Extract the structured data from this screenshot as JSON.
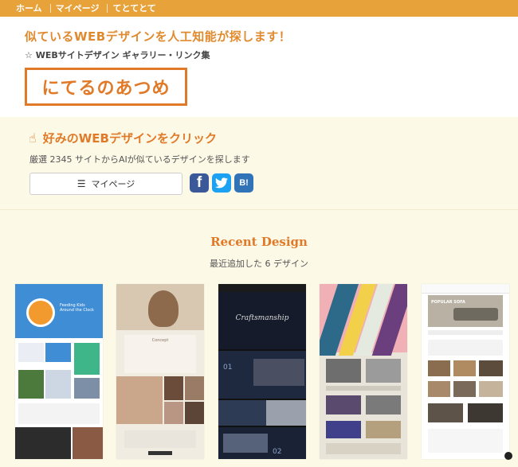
{
  "nav": {
    "items": [
      "ホーム",
      "マイページ",
      "てとてとて"
    ]
  },
  "header": {
    "tagline": "似ているWEBデザインを人工知能が探します！",
    "subtagline": "☆ WEBサイトデザイン ギャラリー・リンク集",
    "logo": "にてるのあつめ"
  },
  "intro": {
    "title": "好みのWEBデザインをクリック",
    "description": "厳選 2345 サイトからAIが似ているデザインを探します",
    "mypage_button": "マイページ"
  },
  "social": {
    "facebook": "f",
    "twitter": "t",
    "hatena": "B!"
  },
  "recent": {
    "title": "Recent Design",
    "subtitle": "最近追加した 6 デザイン"
  },
  "thumbnails": [
    {
      "heading": "Feeding Kids Around the Clock"
    },
    {
      "heading": "Concept"
    },
    {
      "heading": "Craftsmanship",
      "numbers": [
        "01",
        "02"
      ]
    },
    {
      "heading": ""
    },
    {
      "heading": "POPULAR SOFA"
    }
  ],
  "colors": {
    "accent": "#e07a28",
    "nav_bg": "#e7a23a",
    "page_bg": "#fdf9e7"
  },
  "icons": [
    "hand-pointer-icon",
    "list-icon",
    "facebook-icon",
    "twitter-icon",
    "hatena-bookmark-icon"
  ]
}
